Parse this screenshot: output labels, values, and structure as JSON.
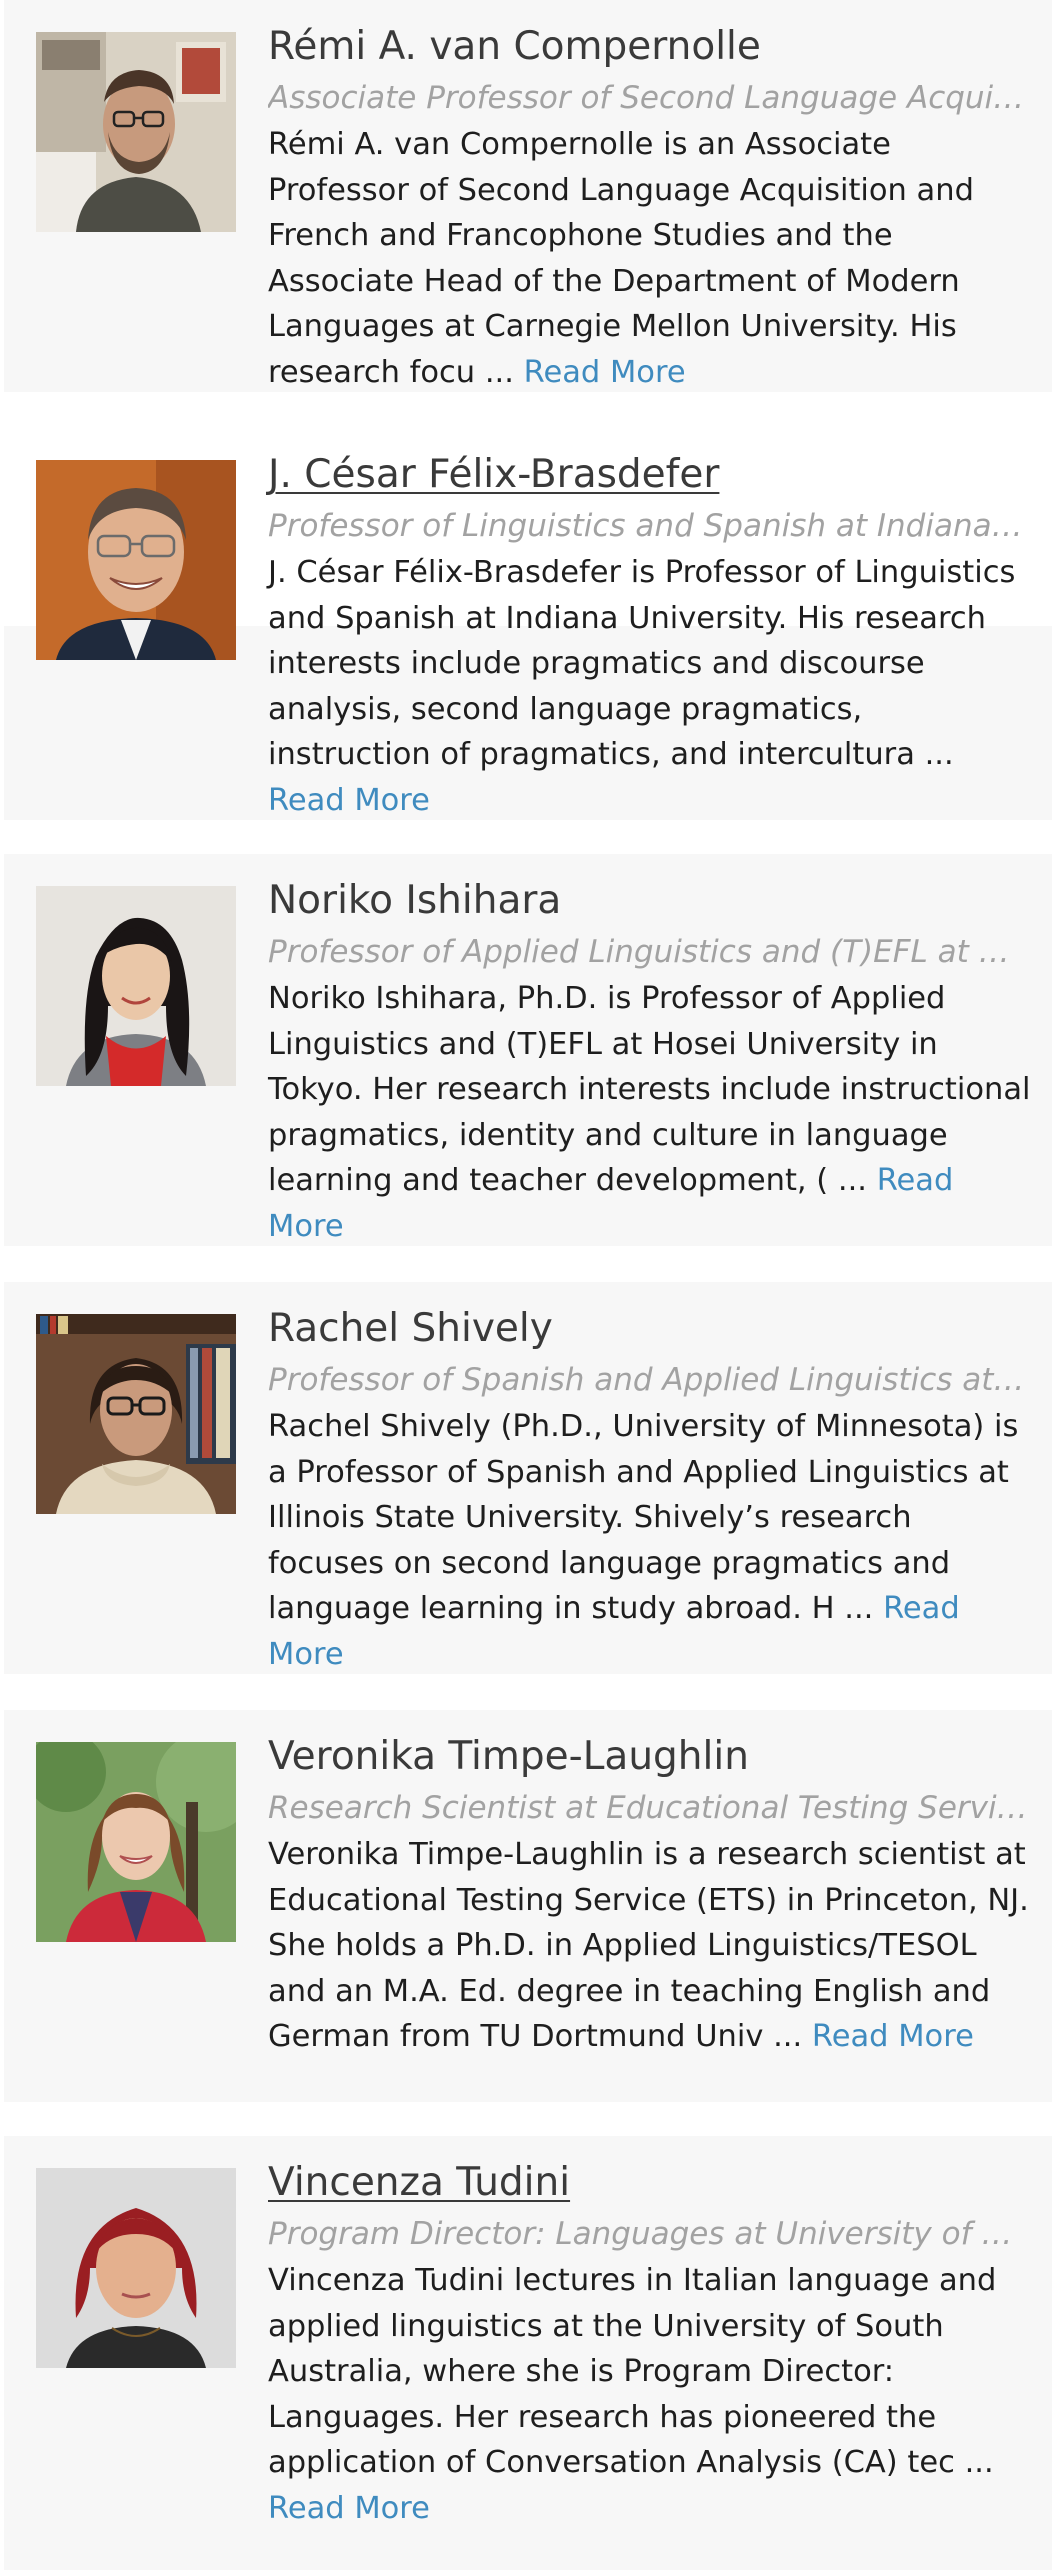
{
  "people": [
    {
      "name": "Rémi A. van Compernolle",
      "title": "Associate Professor of Second Language Acquisition and French and Francophone Studies at Carnegie Mellon University",
      "bio": "Rémi A. van Compernolle is an Associate Professor of Second Language Acquisition and French and Francophone Studies and the Associate Head of the Department of Modern Languages at Carnegie Mellon University. His research focu",
      "ellipsis": "...",
      "read_more": "Read More",
      "photo": "man-with-glasses-in-office-photo"
    },
    {
      "name": "J. César Félix-Brasdefer",
      "title": "Professor of Linguistics and Spanish at Indiana University",
      "bio": "J. César Félix-Brasdefer is Professor of Linguistics and Spanish at Indiana University. His research interests include pragmatics and discourse analysis, second language pragmatics, instruction of pragmatics, and intercultura",
      "ellipsis": "...",
      "read_more": "Read More",
      "photo": "smiling-man-with-glasses-photo"
    },
    {
      "name": "Noriko Ishihara",
      "title": "Professor of Applied Linguistics and (T)EFL at Hosei University",
      "bio": "Noriko Ishihara, Ph.D. is Professor of Applied Linguistics and (T)EFL at Hosei University in Tokyo. Her research interests include instructional pragmatics, identity and culture in language learning and teacher development, (",
      "ellipsis": "...",
      "read_more": "Read More",
      "photo": "woman-in-red-sweater-photo"
    },
    {
      "name": "Rachel Shively",
      "title": "Professor of Spanish and Applied Linguistics at Illinois State University",
      "bio": "Rachel Shively (Ph.D., University of Minnesota) is a Professor of Spanish and Applied Linguistics at Illinois State University. Shively’s research focuses on second language pragmatics and language learning in study abroad. H",
      "ellipsis": "...",
      "read_more": "Read More",
      "photo": "woman-with-glasses-bookshelf-photo"
    },
    {
      "name": "Veronika Timpe-Laughlin",
      "title": "Research Scientist at Educational Testing Service (ETS)",
      "bio": "Veronika Timpe-Laughlin is a research scientist at Educational Testing Service (ETS) in Princeton, NJ. She holds a Ph.D. in Applied Linguistics/TESOL and an M.A. Ed. degree in teaching English and German from TU Dortmund Univ",
      "ellipsis": "...",
      "read_more": "Read More",
      "photo": "woman-in-red-cardigan-outdoors-photo"
    },
    {
      "name": "Vincenza Tudini",
      "title": "Program Director: Languages at University of South Australia",
      "bio": "Vincenza Tudini lectures in Italian language and applied linguistics at the University of South Australia, where she is Program Director: Languages. Her research has pioneered the application of Conversation Analysis (CA) tec",
      "ellipsis": "...",
      "read_more": "Read More",
      "photo": "woman-with-red-hair-photo"
    }
  ]
}
